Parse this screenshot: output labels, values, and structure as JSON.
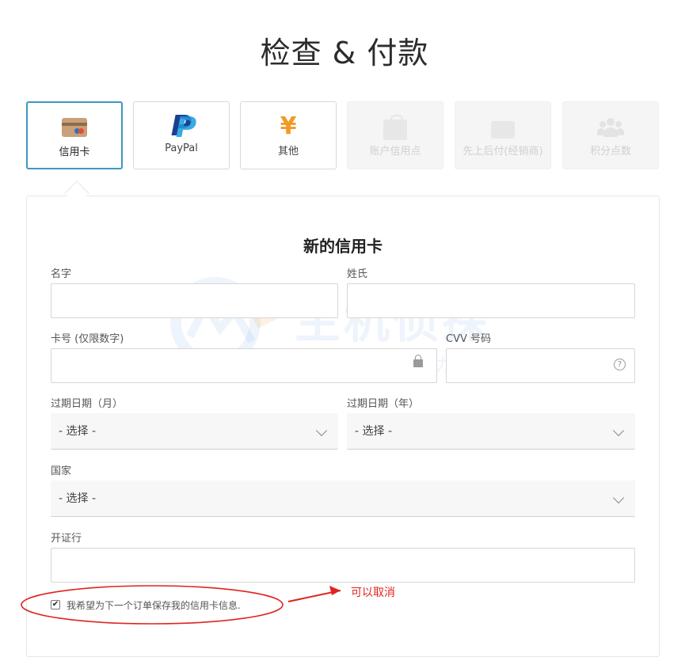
{
  "page": {
    "title": "检查 & 付款"
  },
  "payment_methods": [
    {
      "label": "信用卡",
      "icon": "credit-card-icon",
      "state": "selected"
    },
    {
      "label": "PayPal",
      "icon": "paypal-icon",
      "state": "enabled"
    },
    {
      "label": "其他",
      "icon": "yen-icon",
      "state": "enabled"
    },
    {
      "label": "账户信用点",
      "icon": "shopping-bag-icon",
      "state": "disabled"
    },
    {
      "label": "先上后付(经销商)",
      "icon": "truck-icon",
      "state": "disabled"
    },
    {
      "label": "积分点数",
      "icon": "users-group-icon",
      "state": "disabled"
    }
  ],
  "form": {
    "title": "新的信用卡",
    "first_name": {
      "label": "名字",
      "value": ""
    },
    "last_name": {
      "label": "姓氏",
      "value": ""
    },
    "card_number": {
      "label": "卡号 (仅限数字)",
      "value": ""
    },
    "cvv": {
      "label": "CVV 号码",
      "value": ""
    },
    "exp_month": {
      "label": "过期日期（月）",
      "selected": "- 选择 -"
    },
    "exp_year": {
      "label": "过期日期（年）",
      "selected": "- 选择 -"
    },
    "country": {
      "label": "国家",
      "selected": "- 选择 -"
    },
    "issuing_bank": {
      "label": "开证行",
      "value": ""
    },
    "save_card": {
      "label": "我希望为下一个订单保存我的信用卡信息.",
      "checked": true
    }
  },
  "annotation": {
    "text": "可以取消",
    "color": "#e0231f"
  },
  "watermark": {
    "title": "主机侦探",
    "slogan": "服务跨境电商 助力中企出海"
  },
  "colors": {
    "accent": "#3d98c3",
    "annotation": "#e0231f"
  }
}
